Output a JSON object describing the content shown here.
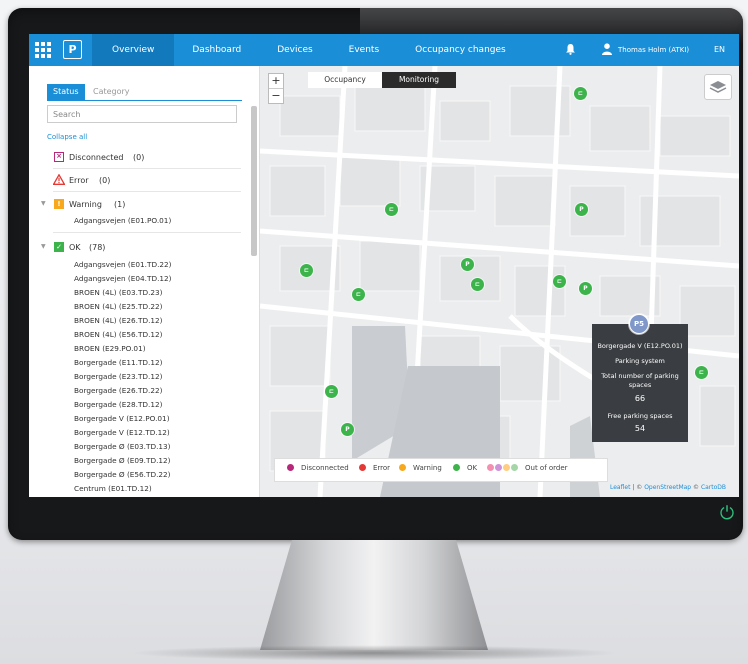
{
  "nav": {
    "logo": "P",
    "items": [
      "Overview",
      "Dashboard",
      "Devices",
      "Events",
      "Occupancy changes"
    ],
    "active_index": 0,
    "user_name": "Thomas Holm (ATKI)",
    "language": "EN"
  },
  "sidebar": {
    "tabs": [
      "Status",
      "Category"
    ],
    "search_placeholder": "Search",
    "collapse_label": "Collapse all",
    "groups": {
      "disconnected": {
        "label": "Disconnected",
        "count": "(0)"
      },
      "error": {
        "label": "Error",
        "count": "(0)"
      },
      "warning": {
        "label": "Warning",
        "count": "(1)",
        "items": [
          "Adgangsvejen (E01.PO.01)"
        ]
      },
      "ok": {
        "label": "OK",
        "count": "(78)",
        "items": [
          "Adgangsvejen (E01.TD.22)",
          "Adgangsvejen (E04.TD.12)",
          "BROEN (4L) (E03.TD.23)",
          "BROEN (4L) (E25.TD.22)",
          "BROEN (4L) (E26.TD.12)",
          "BROEN (4L) (E56.TD.12)",
          "BROEN (E29.PO.01)",
          "Borgergade (E11.TD.12)",
          "Borgergade (E23.TD.12)",
          "Borgergade (E26.TD.22)",
          "Borgergade (E28.TD.12)",
          "Borgergade V (E12.PO.01)",
          "Borgergade V (E12.TD.12)",
          "Borgergade Ø (E03.TD.13)",
          "Borgergade Ø (E09.TD.12)",
          "Borgergade Ø (E56.TD.22)",
          "Centrum (E01.TD.12)"
        ]
      }
    }
  },
  "map": {
    "zoom_in": "+",
    "zoom_out": "−",
    "mode_tabs": [
      "Occupancy",
      "Monitoring"
    ],
    "active_mode": 1,
    "popup": {
      "marker_label": "P5",
      "name": "Borgergade V (E12.PO.01)",
      "type": "Parking system",
      "total_label": "Total number of parking spaces",
      "total_value": "66",
      "free_label": "Free parking spaces",
      "free_value": "54"
    },
    "legend": [
      {
        "label": "Disconnected",
        "color": "#b8277a"
      },
      {
        "label": "Error",
        "color": "#e53935"
      },
      {
        "label": "Warning",
        "color": "#f7a91b"
      },
      {
        "label": "OK",
        "color": "#3cb44b"
      },
      {
        "label": "Out of order",
        "colors": [
          "#f48fb1",
          "#ce93d8",
          "#ffcc80",
          "#a5d6a7"
        ]
      }
    ],
    "attribution": {
      "leaflet": "Leaflet",
      "sep": " | © ",
      "osm": "OpenStreetMap",
      "mid": " © ",
      "carto": "CartoDB"
    }
  },
  "colors": {
    "accent": "#1a8fd8",
    "ok": "#3cb44b",
    "warning": "#f7a91b",
    "popup_bg": "#3a3d41"
  }
}
